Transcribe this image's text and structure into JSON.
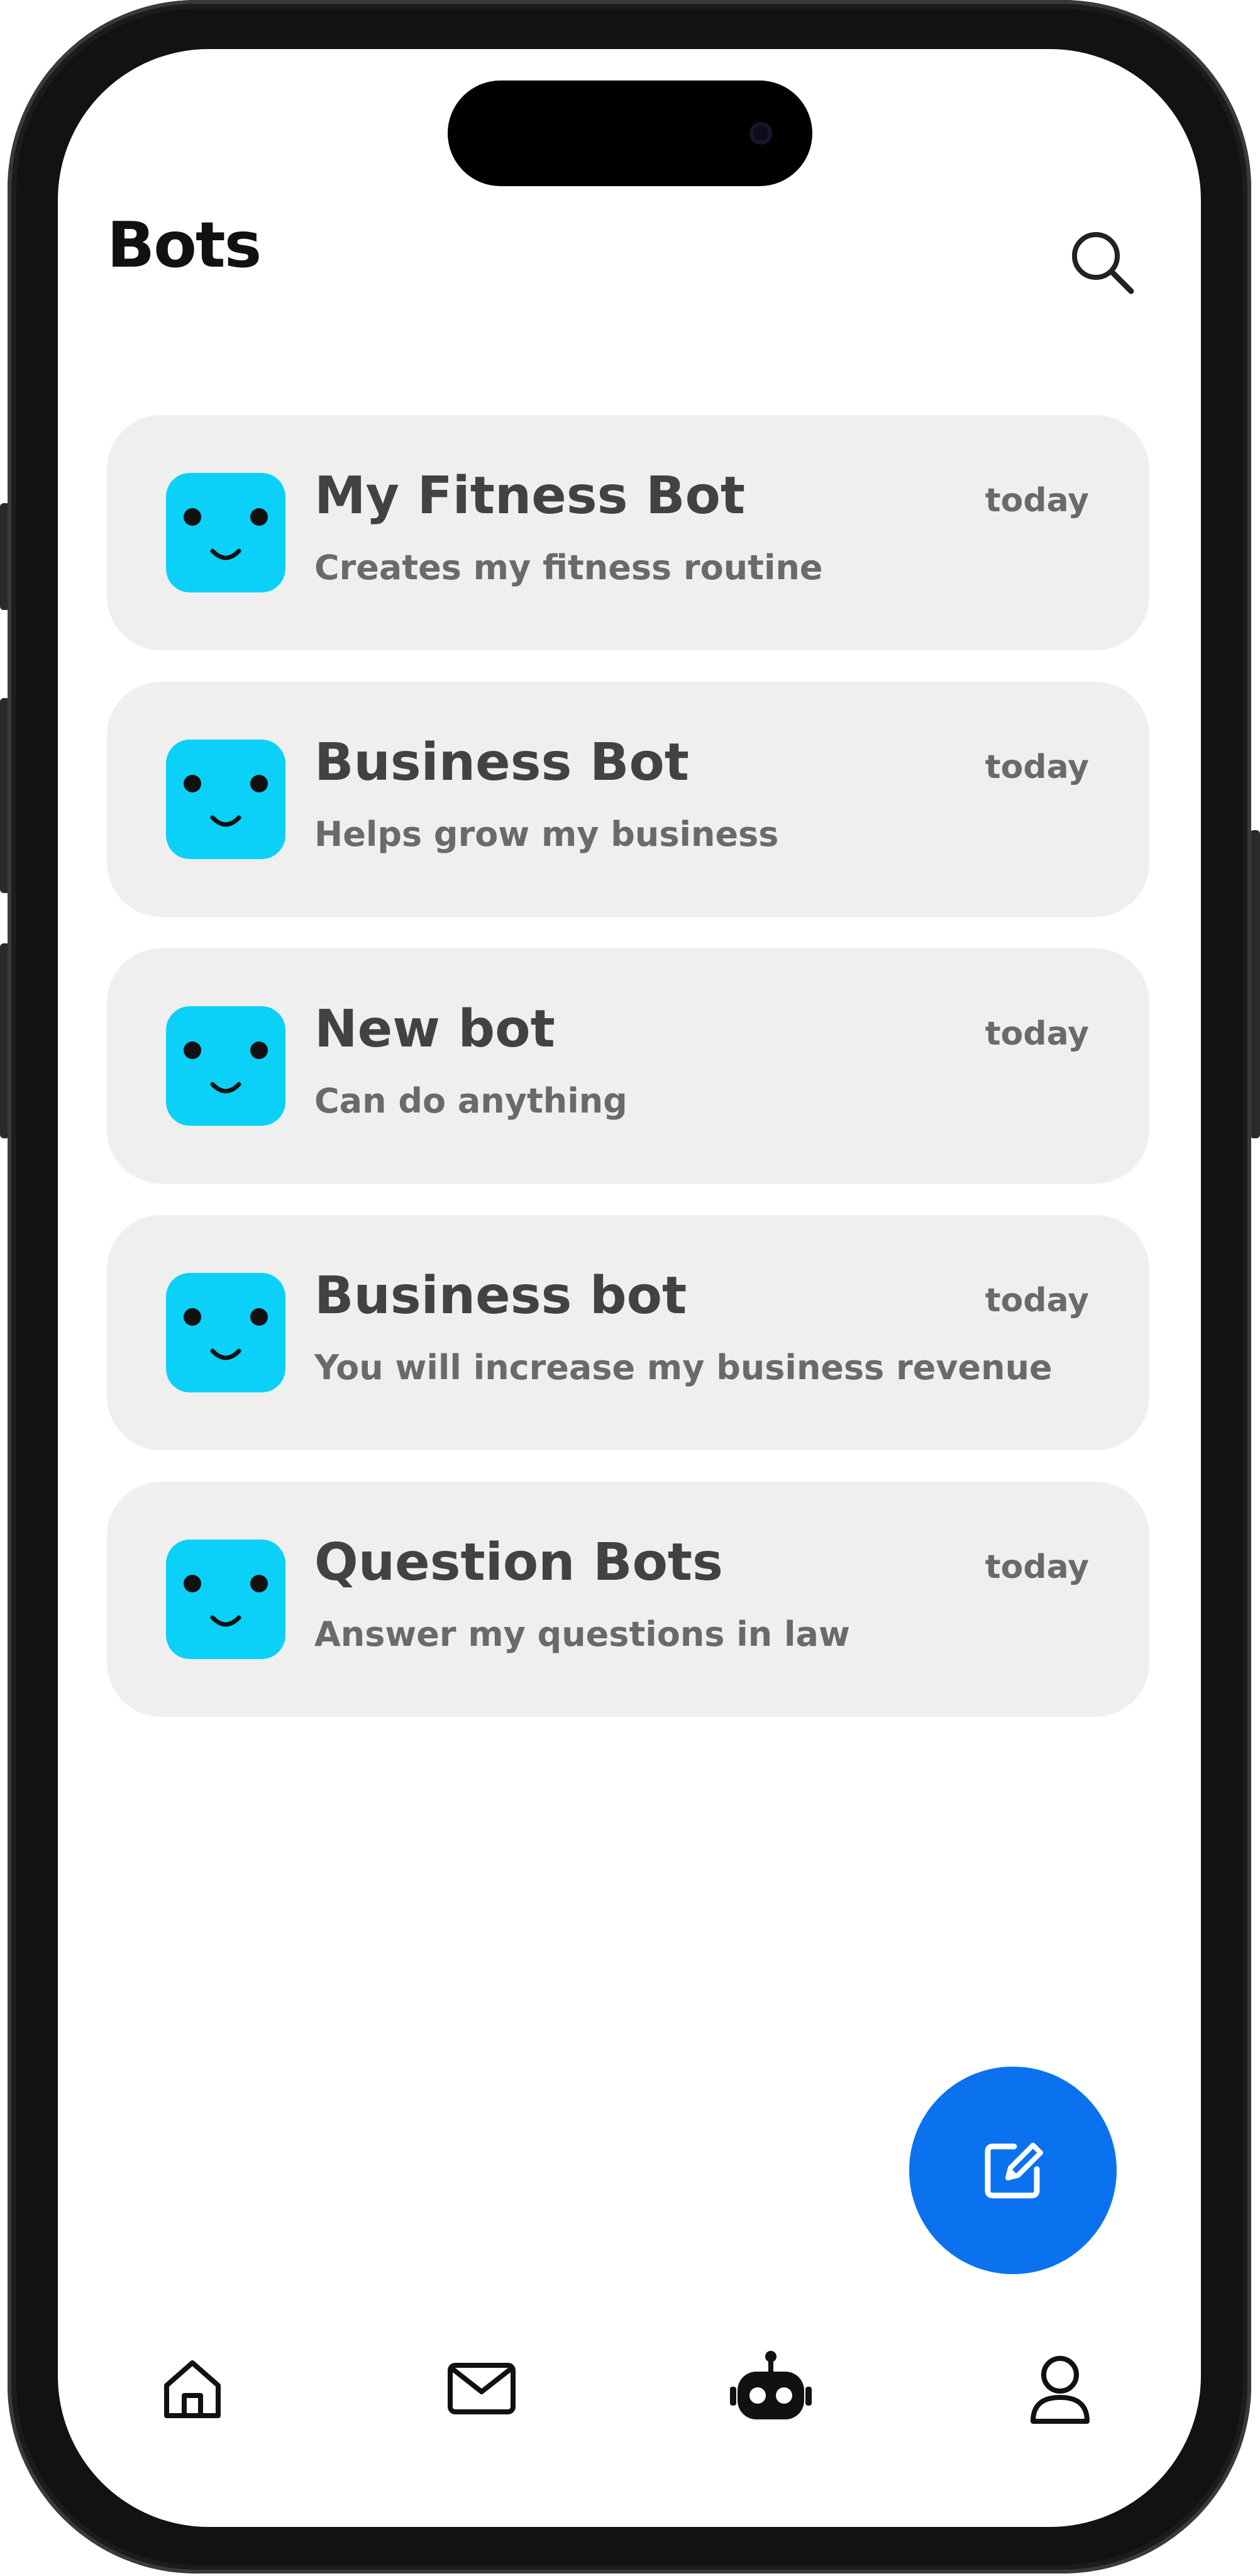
{
  "header": {
    "title": "Bots"
  },
  "bots": [
    {
      "name": "My Fitness Bot",
      "description": "Creates my fitness routine",
      "time": "today"
    },
    {
      "name": "Business Bot",
      "description": "Helps grow my business",
      "time": "today"
    },
    {
      "name": "New bot",
      "description": "Can do anything",
      "time": "today"
    },
    {
      "name": "Business bot",
      "description": "You will increase my business revenue",
      "time": "today"
    },
    {
      "name": "Question Bots",
      "description": "Answer my questions in law",
      "time": "today"
    }
  ],
  "nav": {
    "items": [
      {
        "icon": "home-icon",
        "active": false
      },
      {
        "icon": "mail-icon",
        "active": false
      },
      {
        "icon": "bot-icon",
        "active": true
      },
      {
        "icon": "profile-icon",
        "active": false
      }
    ]
  },
  "fab": {
    "icon": "compose-icon"
  },
  "colors": {
    "accent": "#0B72EF",
    "avatar": "#0BD0F8",
    "card_background": "#EFEFEF",
    "title_text": "#111111",
    "name_text": "#424242",
    "secondary_text": "#6A6A6A"
  }
}
